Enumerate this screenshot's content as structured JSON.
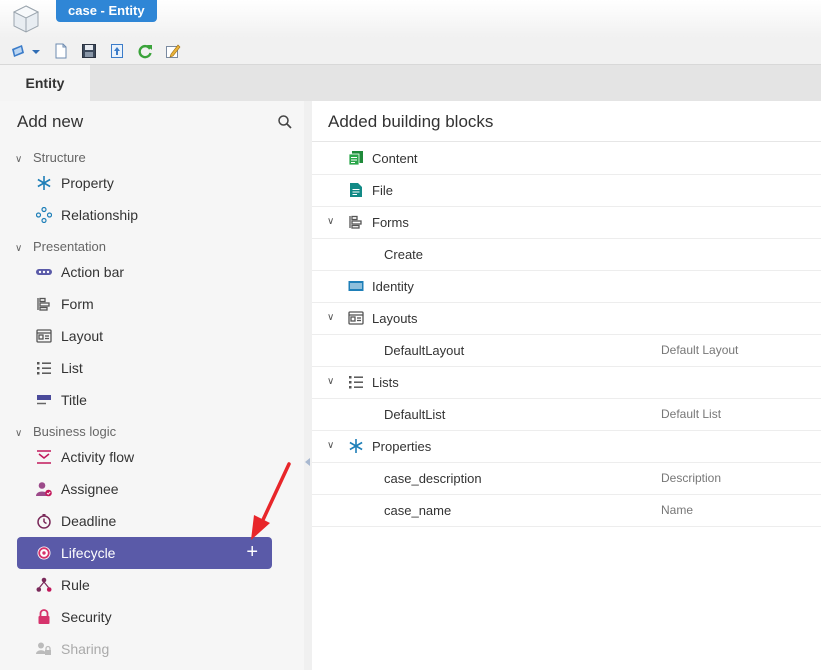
{
  "window": {
    "title": "case - Entity"
  },
  "toolbar": {
    "icons": [
      "navigate-icon",
      "new-document-icon",
      "save-icon",
      "export-icon",
      "refresh-icon",
      "edit-icon"
    ]
  },
  "tabs": [
    {
      "label": "Entity"
    }
  ],
  "left": {
    "title": "Add new",
    "sections": [
      {
        "label": "Structure",
        "items": [
          {
            "label": "Property",
            "icon": "asterisk-icon"
          },
          {
            "label": "Relationship",
            "icon": "relationship-icon"
          }
        ]
      },
      {
        "label": "Presentation",
        "items": [
          {
            "label": "Action bar",
            "icon": "action-bar-icon"
          },
          {
            "label": "Form",
            "icon": "form-icon"
          },
          {
            "label": "Layout",
            "icon": "layout-icon"
          },
          {
            "label": "List",
            "icon": "list-icon"
          },
          {
            "label": "Title",
            "icon": "title-icon"
          }
        ]
      },
      {
        "label": "Business logic",
        "items": [
          {
            "label": "Activity flow",
            "icon": "activity-flow-icon"
          },
          {
            "label": "Assignee",
            "icon": "assignee-icon"
          },
          {
            "label": "Deadline",
            "icon": "deadline-icon"
          },
          {
            "label": "Lifecycle",
            "icon": "lifecycle-icon",
            "selected": true,
            "action": "+"
          },
          {
            "label": "Rule",
            "icon": "rule-icon"
          },
          {
            "label": "Security",
            "icon": "lock-icon"
          },
          {
            "label": "Sharing",
            "icon": "sharing-icon",
            "disabled": true
          }
        ]
      }
    ]
  },
  "right": {
    "title": "Added building blocks",
    "rows": [
      {
        "label": "Content"
      },
      {
        "label": "File"
      },
      {
        "label": "Forms",
        "expandable": true
      },
      {
        "label": "Create",
        "child": true,
        "desc": ""
      },
      {
        "label": "Identity"
      },
      {
        "label": "Layouts",
        "expandable": true
      },
      {
        "label": "DefaultLayout",
        "child": true,
        "desc": "Default Layout"
      },
      {
        "label": "Lists",
        "expandable": true
      },
      {
        "label": "DefaultList",
        "child": true,
        "desc": "Default List"
      },
      {
        "label": "Properties",
        "expandable": true
      },
      {
        "label": "case_description",
        "child": true,
        "desc": "Description"
      },
      {
        "label": "case_name",
        "child": true,
        "desc": "Name"
      }
    ]
  },
  "colors": {
    "accent": "#5a5aa8",
    "title_tab": "#2f86d6",
    "annotation_arrow": "#e8262a"
  }
}
